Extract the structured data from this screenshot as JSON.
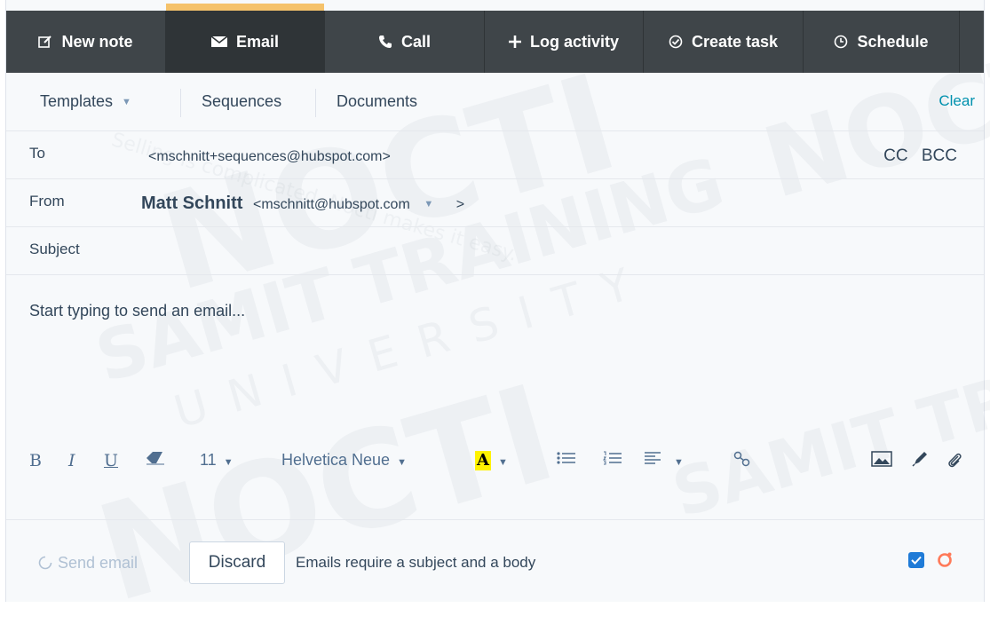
{
  "tabs": [
    {
      "icon": "pencil-square-icon",
      "label": "New note",
      "active": false
    },
    {
      "icon": "envelope-icon",
      "label": "Email",
      "active": true
    },
    {
      "icon": "phone-icon",
      "label": "Call",
      "active": false
    },
    {
      "icon": "plus-icon",
      "label": "Log activity",
      "active": false
    },
    {
      "icon": "check-circle-icon",
      "label": "Create task",
      "active": false
    },
    {
      "icon": "clock-icon",
      "label": "Schedule",
      "active": false
    }
  ],
  "subbar": {
    "templates": "Templates",
    "sequences": "Sequences",
    "documents": "Documents",
    "clear": "Clear"
  },
  "to": {
    "label": "To",
    "value": "<mschnitt+sequences@hubspot.com>",
    "cc": "CC",
    "bcc": "BCC"
  },
  "from": {
    "label": "From",
    "name": "Matt Schnitt",
    "email": "<mschnitt@hubspot.com",
    "suffix": ">"
  },
  "subject": {
    "label": "Subject"
  },
  "body": {
    "placeholder": "Start typing to send an email..."
  },
  "format": {
    "bold": "B",
    "italic": "I",
    "underline": "U",
    "font_size": "11",
    "font_family": "Helvetica Neue",
    "highlight": "A"
  },
  "footer": {
    "send": "Send email",
    "discard": "Discard",
    "message": "Emails require a subject and a body"
  },
  "watermark": {
    "brand1": "NOCTI",
    "brand2": "SAMIT TRAINING",
    "university": "UNIVERSITY",
    "tagline": "Selling is complicated. Nocti makes it easy."
  },
  "colors": {
    "accent": "#f5c26b",
    "link": "#0091ae",
    "tabbar": "#3f4549",
    "checkbox": "#1f7bd7",
    "sprocket": "#ff7a59"
  }
}
